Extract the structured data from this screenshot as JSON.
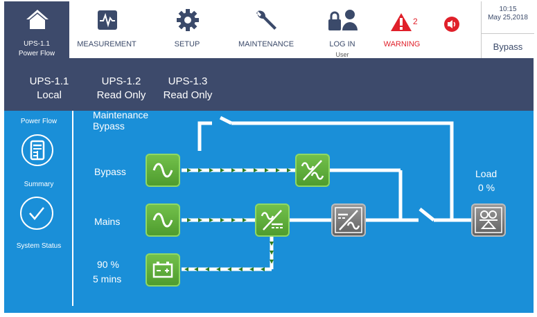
{
  "header": {
    "home": {
      "line1": "UPS-1.1",
      "line2": "Power Flow"
    },
    "nav": [
      {
        "key": "measurement",
        "label": "MEASUREMENT"
      },
      {
        "key": "setup",
        "label": "SETUP"
      },
      {
        "key": "maintenance",
        "label": "MAINTENANCE"
      },
      {
        "key": "login",
        "label": "LOG IN",
        "sub": "User"
      },
      {
        "key": "warning",
        "label": "WARNING",
        "badge": "2"
      }
    ],
    "clock": {
      "time": "10:15",
      "date": "May 25,2018"
    },
    "mode": "Bypass"
  },
  "units": [
    {
      "name": "UPS-1.1",
      "state": "Local"
    },
    {
      "name": "UPS-1.2",
      "state": "Read Only"
    },
    {
      "name": "UPS-1.3",
      "state": "Read Only"
    }
  ],
  "sidebar": {
    "items": [
      {
        "label": "Power Flow"
      },
      {
        "label": "Summary"
      },
      {
        "label": "System Status"
      }
    ]
  },
  "diagram": {
    "maintenance_bypass": [
      "Maintenance",
      "Bypass"
    ],
    "bypass": "Bypass",
    "mains": "Mains",
    "battery_level": "90 %",
    "battery_time": "5 mins",
    "load_label": "Load",
    "load_value": "0 %"
  },
  "colors": {
    "header_bg": "#3d4a6b",
    "main_bg": "#1a8fd8",
    "tile_green": "#5aad36",
    "tile_gray": "#7a7a7a",
    "warning": "#e0202a",
    "flow_arrow": "#2f7d1f"
  },
  "icons": {
    "home": "home-icon",
    "measurement": "waveform-icon",
    "setup": "gear-icon",
    "maintenance": "wrench-icon",
    "login": "lock-user-icon",
    "warning": "warning-icon",
    "sound": "speaker-icon"
  }
}
